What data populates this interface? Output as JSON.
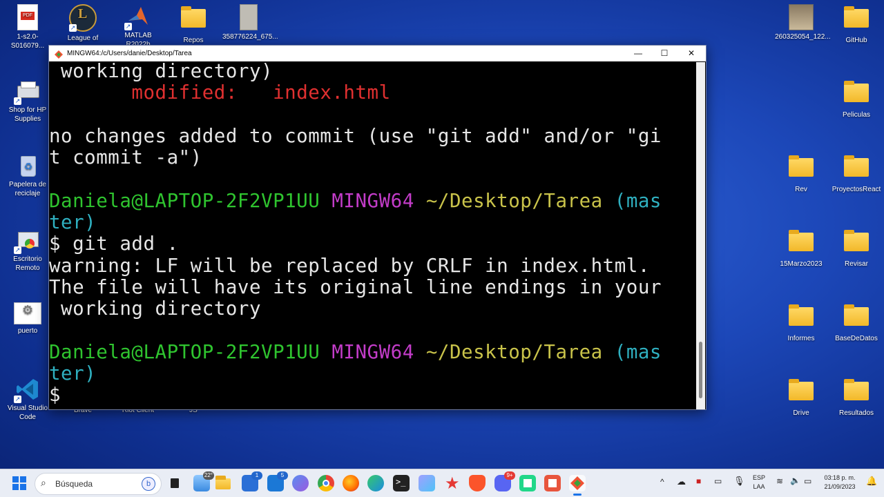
{
  "desktop": {
    "icons": [
      {
        "label": "1-s2.0-S016079...",
        "kind": "pdf"
      },
      {
        "label": "League of",
        "kind": "league"
      },
      {
        "label": "MATLAB R2022b",
        "kind": "matlab"
      },
      {
        "label": "Repos",
        "kind": "folder"
      },
      {
        "label": "358776224_675...",
        "kind": "image"
      },
      {
        "label": "260325054_122...",
        "kind": "image"
      },
      {
        "label": "GitHub",
        "kind": "folder"
      },
      {
        "label": "Shop for HP Supplies",
        "kind": "hp"
      },
      {
        "label": "Peliculas",
        "kind": "folder"
      },
      {
        "label": "Papelera de reciclaje",
        "kind": "recycle"
      },
      {
        "label": "Rev",
        "kind": "folder"
      },
      {
        "label": "ProyectosReact",
        "kind": "folder"
      },
      {
        "label": "Escritorio Remoto",
        "kind": "remote"
      },
      {
        "label": "15Marzo2023",
        "kind": "folder"
      },
      {
        "label": "Revisar",
        "kind": "folder"
      },
      {
        "label": "puerto",
        "kind": "settings"
      },
      {
        "label": "Informes",
        "kind": "folder"
      },
      {
        "label": "BaseDeDatos",
        "kind": "folder"
      },
      {
        "label": "Visual Studio Code",
        "kind": "vscode"
      },
      {
        "label": "Brave",
        "kind": "hidden"
      },
      {
        "label": "Riot Client",
        "kind": "hidden"
      },
      {
        "label": "JS",
        "kind": "hidden"
      },
      {
        "label": "Drive",
        "kind": "folder"
      },
      {
        "label": "Resultados",
        "kind": "folder"
      }
    ]
  },
  "window": {
    "title": "MINGW64:/c/Users/danie/Desktop/Tarea",
    "minimize": "—",
    "maximize": "☐",
    "close": "✕"
  },
  "terminal": {
    "lines": {
      "l1": " working directory)",
      "l2_indent": "       ",
      "l2_label": "modified:   ",
      "l2_file": "index.html",
      "l4": "no changes added to commit (use \"git add\" and/or \"gi",
      "l5": "t commit -a\")",
      "p1_user": "Daniela@LAPTOP-2F2VP1UU",
      "p1_sys": "MINGW64",
      "p1_path": "~/Desktop/Tarea",
      "p1_branch_a": "(mas",
      "p1_branch_b": "ter)",
      "cmd": "$ git add .",
      "w1": "warning: LF will be replaced by CRLF in index.html.",
      "w2": "The file will have its original line endings in your",
      "w3": " working directory",
      "p2_user": "Daniela@LAPTOP-2F2VP1UU",
      "p2_sys": "MINGW64",
      "p2_path": "~/Desktop/Tarea",
      "p2_branch_a": "(mas",
      "p2_branch_b": "ter)",
      "prompt": "$"
    }
  },
  "taskbar": {
    "search_placeholder": "Búsqueda",
    "weather_badge": "22°",
    "store_badge": "1",
    "mail_badge": "5",
    "discord_badge": "9+",
    "lang_top": "ESP",
    "lang_bottom": "LAA",
    "time": "03:18 p. m.",
    "date": "21/09/2023"
  },
  "colors": {
    "prompt_user": "#2fc42f",
    "prompt_system": "#c23cc8",
    "prompt_path": "#c9c34a",
    "prompt_branch": "#2fb0c0",
    "modified": "#e03030"
  }
}
